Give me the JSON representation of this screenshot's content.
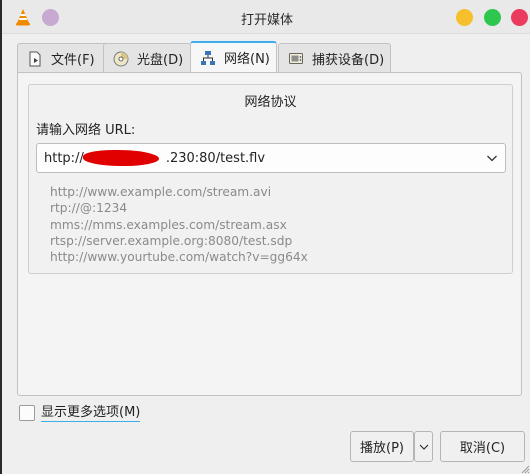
{
  "window": {
    "title": "打开媒体",
    "buttons": {
      "minimize_color": "#f6c02d",
      "maximize_color": "#2ec74e",
      "close_color": "#ea3c5f",
      "menu_color": "#c7a9d2"
    },
    "accent_color": "#3daee9"
  },
  "tabs": [
    {
      "label": "文件(F)",
      "icon": "file-icon",
      "active": false
    },
    {
      "label": "光盘(D)",
      "icon": "disc-icon",
      "active": false
    },
    {
      "label": "网络(N)",
      "icon": "network-icon",
      "active": true
    },
    {
      "label": "捕获设备(D)",
      "icon": "capture-device-icon",
      "active": false
    }
  ],
  "network": {
    "group_title": "网络协议",
    "url_label": "请输入网络 URL:",
    "url_value_prefix": "http://",
    "url_value_suffix": ".230:80/test.flv",
    "examples": [
      "http://www.example.com/stream.avi",
      "rtp://@:1234",
      "mms://mms.examples.com/stream.asx",
      "rtsp://server.example.org:8080/test.sdp",
      "http://www.yourtube.com/watch?v=gg64x"
    ]
  },
  "footer": {
    "show_more_label": "显示更多选项(M)",
    "show_more_checked": false,
    "play_label": "播放(P)",
    "cancel_label": "取消(C)"
  }
}
